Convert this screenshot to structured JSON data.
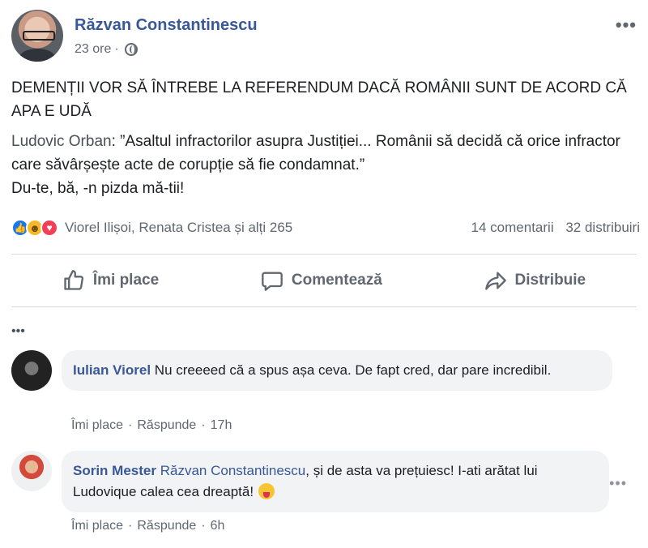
{
  "post": {
    "author": "Răzvan Constantinescu",
    "time": "23 ore",
    "meta_sep": "·",
    "text": "DEMENȚII VOR SĂ ÎNTREBE LA REFERENDUM DACĂ ROMÂNII SUNT DE ACORD CĂ APA E UDĂ",
    "quote_author": "Ludovic Orban",
    "quote_text": ": ”Asaltul infractorilor asupra Justiției... Românii să decidă că orice infractor care săvârșește acte de corupție să fie condamnat.”",
    "quote_reply": "Du-te, bă, -n pizda mă-tii!",
    "more_label": "•••"
  },
  "reactions": {
    "types": [
      "like",
      "haha",
      "love"
    ],
    "names": "Viorel Ilișoi, Renata Cristea și alți 265",
    "comments_count": "14 comentarii",
    "shares_count": "32 distribuiri"
  },
  "actions": {
    "like": "Îmi place",
    "comment": "Comentează",
    "share": "Distribuie"
  },
  "comments": {
    "more_label": "•••",
    "items": [
      {
        "author": "Iulian Viorel",
        "text": "Nu creeeed că a spus așa ceva. De fapt cred, dar pare incredibil.",
        "like": "Îmi place",
        "reply": "Răspunde",
        "time": "17h"
      },
      {
        "author": "Sorin Mester",
        "mention": "Răzvan Constantinescu",
        "text": ", și de asta va prețuiesc! I-ati arătat lui Ludovique calea cea dreaptă!",
        "like": "Îmi place",
        "reply": "Răspunde",
        "time": "6h"
      }
    ],
    "sep": "·"
  },
  "colors": {
    "link": "#385898",
    "muted": "#606770",
    "bubble": "#f2f3f5",
    "like": "#1877f2",
    "love": "#f33e58",
    "haha": "#f7b928"
  }
}
